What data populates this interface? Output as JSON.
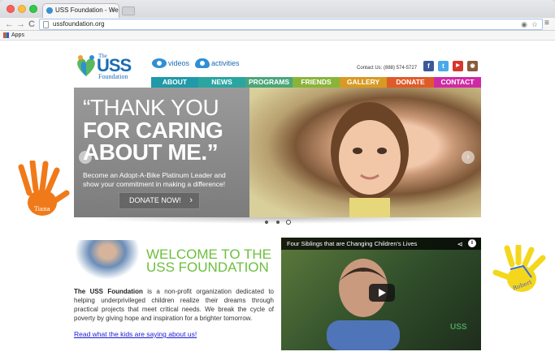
{
  "browser": {
    "tab_title": "USS Foundation - Welcom",
    "tab_close": "×",
    "url": "ussfoundation.org",
    "bookmarks": {
      "apps": "Apps"
    },
    "nav": {
      "back": "←",
      "forward": "→",
      "reload": "C"
    },
    "menu": "≡"
  },
  "site": {
    "logo": {
      "the": "The",
      "uss": "USS",
      "foundation": "Foundation"
    },
    "media_links": {
      "videos": "videos",
      "activities": "activities"
    },
    "contact": "Contact Us: (888) 574-5727",
    "social": [
      {
        "name": "facebook",
        "glyph": "f",
        "color": "#3b5998"
      },
      {
        "name": "twitter",
        "glyph": "t",
        "color": "#4aa9e8"
      },
      {
        "name": "youtube",
        "glyph": "▶",
        "color": "#d9362b"
      },
      {
        "name": "instagram",
        "glyph": "◉",
        "color": "#8a5a3c"
      }
    ],
    "menu": [
      {
        "label": "ABOUT",
        "color": "#1f9aa8"
      },
      {
        "label": "NEWS",
        "color": "#2aa5a0"
      },
      {
        "label": "PROGRAMS",
        "color": "#4aa67a"
      },
      {
        "label": "FRIENDS",
        "color": "#89b43a"
      },
      {
        "label": "GALLERY",
        "color": "#d89a23"
      },
      {
        "label": "DONATE",
        "color": "#df5b2a"
      },
      {
        "label": "CONTACT",
        "color": "#cf2aa6"
      }
    ],
    "hero": {
      "line1": "“THANK YOU",
      "line2": "FOR CARING",
      "line3": "ABOUT ME.”",
      "sub1": "Become an Adopt-A-Bike Platinum Leader and",
      "sub2": "show your commitment in making a difference!",
      "button": "DONATE NOW!",
      "button_chevron": "›",
      "prev": "‹",
      "next": "›",
      "slides": 3,
      "active_slide": 3
    },
    "hands": {
      "left_name": "Tiana",
      "right_name": "Robert"
    },
    "welcome": {
      "title1": "WELCOME TO THE",
      "title2": "USS FOUNDATION",
      "org": "The USS Foundation",
      "body": " is a non-profit organization dedicated to helping underprivileged children realize their dreams through practical projects that meet critical needs. We break the cycle of poverty by giving hope and inspiration for a brighter tomorrow.",
      "link": "Read what the kids are saying about us!"
    },
    "video": {
      "title": "Four Siblings that are Changing Children's Lives",
      "share": "⋖",
      "info": "i",
      "watermark": "USS"
    }
  }
}
